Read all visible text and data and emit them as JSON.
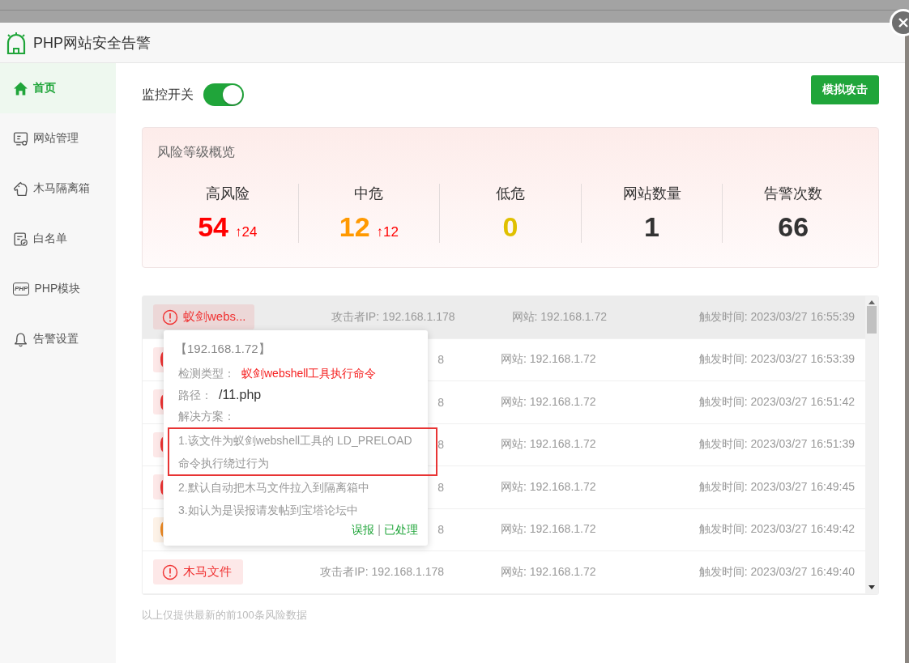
{
  "window": {
    "title": "PHP网站安全告警"
  },
  "sidebar": {
    "items": [
      {
        "kind": "home",
        "label": "首页",
        "selected": true
      },
      {
        "kind": "monitor",
        "label": "网站管理",
        "selected": false
      },
      {
        "kind": "horse",
        "label": "木马隔离箱",
        "selected": false
      },
      {
        "kind": "list",
        "label": "白名单",
        "selected": false
      },
      {
        "kind": "php",
        "label": "PHP模块",
        "icon_text": "PHP",
        "selected": false
      },
      {
        "kind": "bell",
        "label": "告警设置",
        "selected": false
      }
    ]
  },
  "monitor_switch": {
    "label": "监控开关",
    "on": true
  },
  "simulate_button": "模拟攻击",
  "overview": {
    "title": "风险等级概览",
    "stats": [
      {
        "label": "高风险",
        "value": "54",
        "delta": "↑24",
        "color": "#ff0000"
      },
      {
        "label": "中危",
        "value": "12",
        "delta": "↑12",
        "color": "#ff9900"
      },
      {
        "label": "低危",
        "value": "0",
        "color": "#e0c000"
      },
      {
        "label": "网站数量",
        "value": "1",
        "color": "#333333"
      },
      {
        "label": "告警次数",
        "value": "66",
        "color": "#333333"
      }
    ]
  },
  "alerts": [
    {
      "color": "#f03030",
      "badge": "蚁剑webs...",
      "attacker": "攻击者IP: 192.168.1.178",
      "site": "网站: 192.168.1.72",
      "time": "触发时间: 2023/03/27 16:55:39",
      "selected": true
    },
    {
      "color": "#f03030",
      "attacker": "8",
      "site": "网站: 192.168.1.72",
      "time": "触发时间: 2023/03/27 16:53:39",
      "selected": false
    },
    {
      "color": "#f03030",
      "attacker": "8",
      "site": "网站: 192.168.1.72",
      "time": "触发时间: 2023/03/27 16:51:42",
      "selected": false
    },
    {
      "color": "#f03030",
      "attacker": "8",
      "site": "网站: 192.168.1.72",
      "time": "触发时间: 2023/03/27 16:51:39",
      "selected": false
    },
    {
      "color": "#f03030",
      "attacker": "8",
      "site": "网站: 192.168.1.72",
      "time": "触发时间: 2023/03/27 16:49:45",
      "selected": false
    },
    {
      "color": "#f08a20",
      "attacker": "8",
      "site": "网站: 192.168.1.72",
      "time": "触发时间: 2023/03/27 16:49:42",
      "selected": false
    },
    {
      "color": "#f03030",
      "badge": "木马文件",
      "attacker": "攻击者IP: 192.168.1.178",
      "site": "网站: 192.168.1.72",
      "time": "触发时间: 2023/03/27 16:49:40",
      "selected": false
    }
  ],
  "popup": {
    "title": "【192.168.1.72】",
    "type_label": "检测类型：",
    "type_value": "蚁剑webshell工具执行命令",
    "path_label": "路径：",
    "path_value": "/11.php",
    "solution_label": "解决方案：",
    "solutions": [
      {
        "text": "1.该文件为蚁剑webshell工具的 LD_PRELOAD 命令执行绕过行为",
        "highlighted": true
      },
      {
        "text": "2.默认自动把木马文件拉入到隔离箱中",
        "highlighted": false
      },
      {
        "text": "3.如认为是误报请发帖到宝塔论坛中",
        "highlighted": false
      }
    ],
    "actions": [
      "误报",
      "已处理"
    ],
    "separator": "|"
  },
  "footer_note": "以上仅提供最新的前100条风险数据"
}
